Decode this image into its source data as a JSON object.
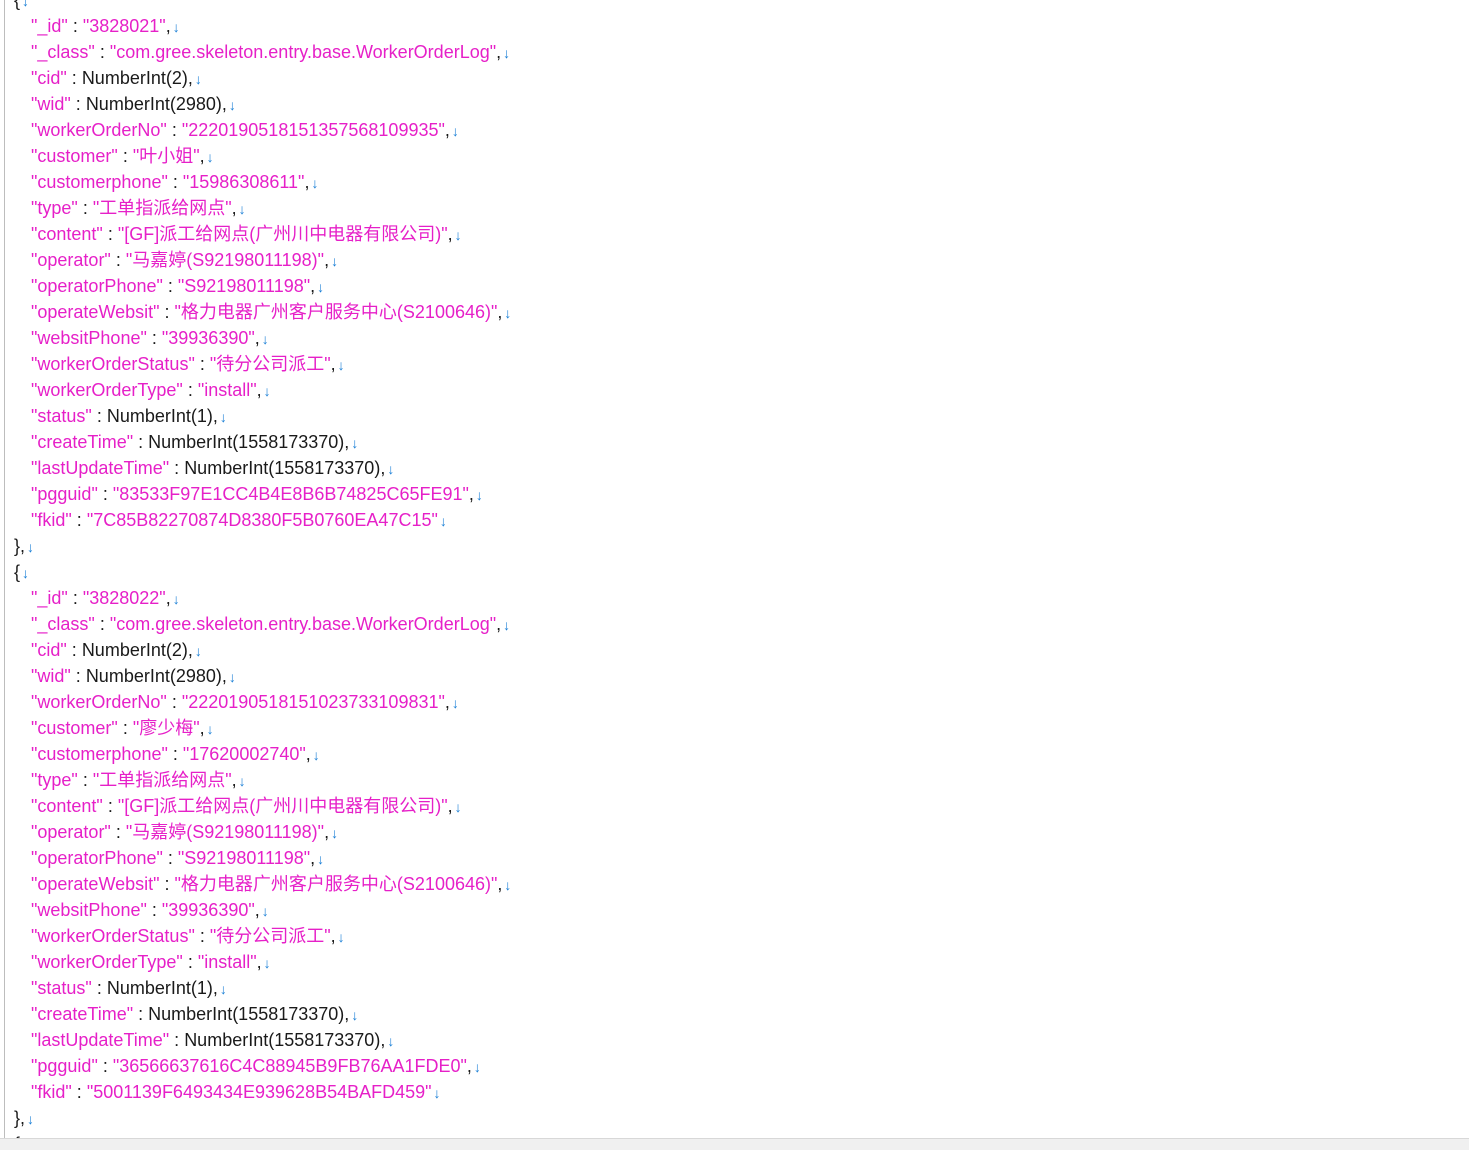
{
  "eol_marker": "↓",
  "top_partial": "{",
  "bottom_partial": "{",
  "records": [
    {
      "open": "{",
      "close": "},",
      "fields": [
        {
          "key": "\"_id\"",
          "value": "\"3828021\"",
          "vtype": "str",
          "comma": ","
        },
        {
          "key": "\"_class\"",
          "value": "\"com.gree.skeleton.entry.base.WorkerOrderLog\"",
          "vtype": "str",
          "comma": ","
        },
        {
          "key": "\"cid\"",
          "value": "NumberInt(2)",
          "vtype": "plain",
          "comma": ","
        },
        {
          "key": "\"wid\"",
          "value": "NumberInt(2980)",
          "vtype": "plain",
          "comma": ","
        },
        {
          "key": "\"workerOrderNo\"",
          "value": "\"2220190518151357568109935\"",
          "vtype": "str",
          "comma": ","
        },
        {
          "key": "\"customer\"",
          "value": "\"叶小姐\"",
          "vtype": "str",
          "comma": ","
        },
        {
          "key": "\"customerphone\"",
          "value": "\"15986308611\"",
          "vtype": "str",
          "comma": ","
        },
        {
          "key": "\"type\"",
          "value": "\"工单指派给网点\"",
          "vtype": "str",
          "comma": ","
        },
        {
          "key": "\"content\"",
          "value": "\"[GF]派工给网点(广州川中电器有限公司)\"",
          "vtype": "str",
          "comma": ","
        },
        {
          "key": "\"operator\"",
          "value": "\"马嘉婷(S92198011198)\"",
          "vtype": "str",
          "comma": ","
        },
        {
          "key": "\"operatorPhone\"",
          "value": "\"S92198011198\"",
          "vtype": "str",
          "comma": ","
        },
        {
          "key": "\"operateWebsit\"",
          "value": "\"格力电器广州客户服务中心(S2100646)\"",
          "vtype": "str",
          "comma": ","
        },
        {
          "key": "\"websitPhone\"",
          "value": "\"39936390\"",
          "vtype": "str",
          "comma": ","
        },
        {
          "key": "\"workerOrderStatus\"",
          "value": "\"待分公司派工\"",
          "vtype": "str",
          "comma": ","
        },
        {
          "key": "\"workerOrderType\"",
          "value": "\"install\"",
          "vtype": "str",
          "comma": ","
        },
        {
          "key": "\"status\"",
          "value": "NumberInt(1)",
          "vtype": "plain",
          "comma": ","
        },
        {
          "key": "\"createTime\"",
          "value": "NumberInt(1558173370)",
          "vtype": "plain",
          "comma": ","
        },
        {
          "key": "\"lastUpdateTime\"",
          "value": "NumberInt(1558173370)",
          "vtype": "plain",
          "comma": ","
        },
        {
          "key": "\"pgguid\"",
          "value": "\"83533F97E1CC4B4E8B6B74825C65FE91\"",
          "vtype": "str",
          "comma": ","
        },
        {
          "key": "\"fkid\"",
          "value": "\"7C85B82270874D8380F5B0760EA47C15\"",
          "vtype": "str",
          "comma": ""
        }
      ]
    },
    {
      "open": "{",
      "close": "},",
      "fields": [
        {
          "key": "\"_id\"",
          "value": "\"3828022\"",
          "vtype": "str",
          "comma": ","
        },
        {
          "key": "\"_class\"",
          "value": "\"com.gree.skeleton.entry.base.WorkerOrderLog\"",
          "vtype": "str",
          "comma": ","
        },
        {
          "key": "\"cid\"",
          "value": "NumberInt(2)",
          "vtype": "plain",
          "comma": ","
        },
        {
          "key": "\"wid\"",
          "value": "NumberInt(2980)",
          "vtype": "plain",
          "comma": ","
        },
        {
          "key": "\"workerOrderNo\"",
          "value": "\"2220190518151023733109831\"",
          "vtype": "str",
          "comma": ","
        },
        {
          "key": "\"customer\"",
          "value": "\"廖少梅\"",
          "vtype": "str",
          "comma": ","
        },
        {
          "key": "\"customerphone\"",
          "value": "\"17620002740\"",
          "vtype": "str",
          "comma": ","
        },
        {
          "key": "\"type\"",
          "value": "\"工单指派给网点\"",
          "vtype": "str",
          "comma": ","
        },
        {
          "key": "\"content\"",
          "value": "\"[GF]派工给网点(广州川中电器有限公司)\"",
          "vtype": "str",
          "comma": ","
        },
        {
          "key": "\"operator\"",
          "value": "\"马嘉婷(S92198011198)\"",
          "vtype": "str",
          "comma": ","
        },
        {
          "key": "\"operatorPhone\"",
          "value": "\"S92198011198\"",
          "vtype": "str",
          "comma": ","
        },
        {
          "key": "\"operateWebsit\"",
          "value": "\"格力电器广州客户服务中心(S2100646)\"",
          "vtype": "str",
          "comma": ","
        },
        {
          "key": "\"websitPhone\"",
          "value": "\"39936390\"",
          "vtype": "str",
          "comma": ","
        },
        {
          "key": "\"workerOrderStatus\"",
          "value": "\"待分公司派工\"",
          "vtype": "str",
          "comma": ","
        },
        {
          "key": "\"workerOrderType\"",
          "value": "\"install\"",
          "vtype": "str",
          "comma": ","
        },
        {
          "key": "\"status\"",
          "value": "NumberInt(1)",
          "vtype": "plain",
          "comma": ","
        },
        {
          "key": "\"createTime\"",
          "value": "NumberInt(1558173370)",
          "vtype": "plain",
          "comma": ","
        },
        {
          "key": "\"lastUpdateTime\"",
          "value": "NumberInt(1558173370)",
          "vtype": "plain",
          "comma": ","
        },
        {
          "key": "\"pgguid\"",
          "value": "\"36566637616C4C88945B9FB76AA1FDE0\"",
          "vtype": "str",
          "comma": ","
        },
        {
          "key": "\"fkid\"",
          "value": "\"5001139F6493434E939628B54BAFD459\"",
          "vtype": "str",
          "comma": ""
        }
      ]
    }
  ]
}
